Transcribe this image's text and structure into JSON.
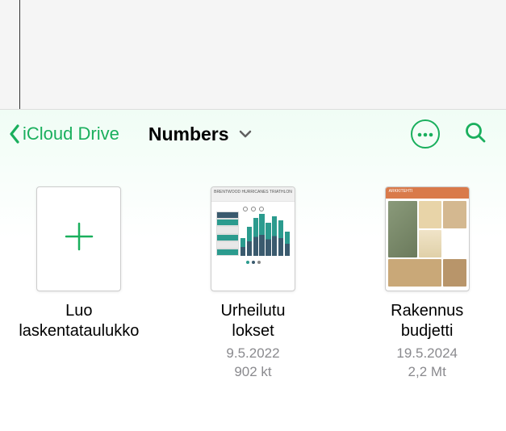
{
  "accent_color": "#1aaf5d",
  "toolbar": {
    "back_label": "iCloud Drive",
    "title": "Numbers"
  },
  "items": [
    {
      "label_line1": "Luo",
      "label_line2": "laskentataulukko",
      "date": "",
      "size": "",
      "type": "create"
    },
    {
      "label_line1": "Urheilutu",
      "label_line2": "lokset",
      "date": "9.5.2022",
      "size": "902 kt",
      "type": "doc",
      "thumb_title": "BRENTWOOD HURRICANES TRIATHLON"
    },
    {
      "label_line1": "Rakennus",
      "label_line2": "budjetti",
      "date": "19.5.2024",
      "size": "2,2 Mt",
      "type": "doc",
      "thumb_title": "ARKKITEHTI"
    }
  ]
}
